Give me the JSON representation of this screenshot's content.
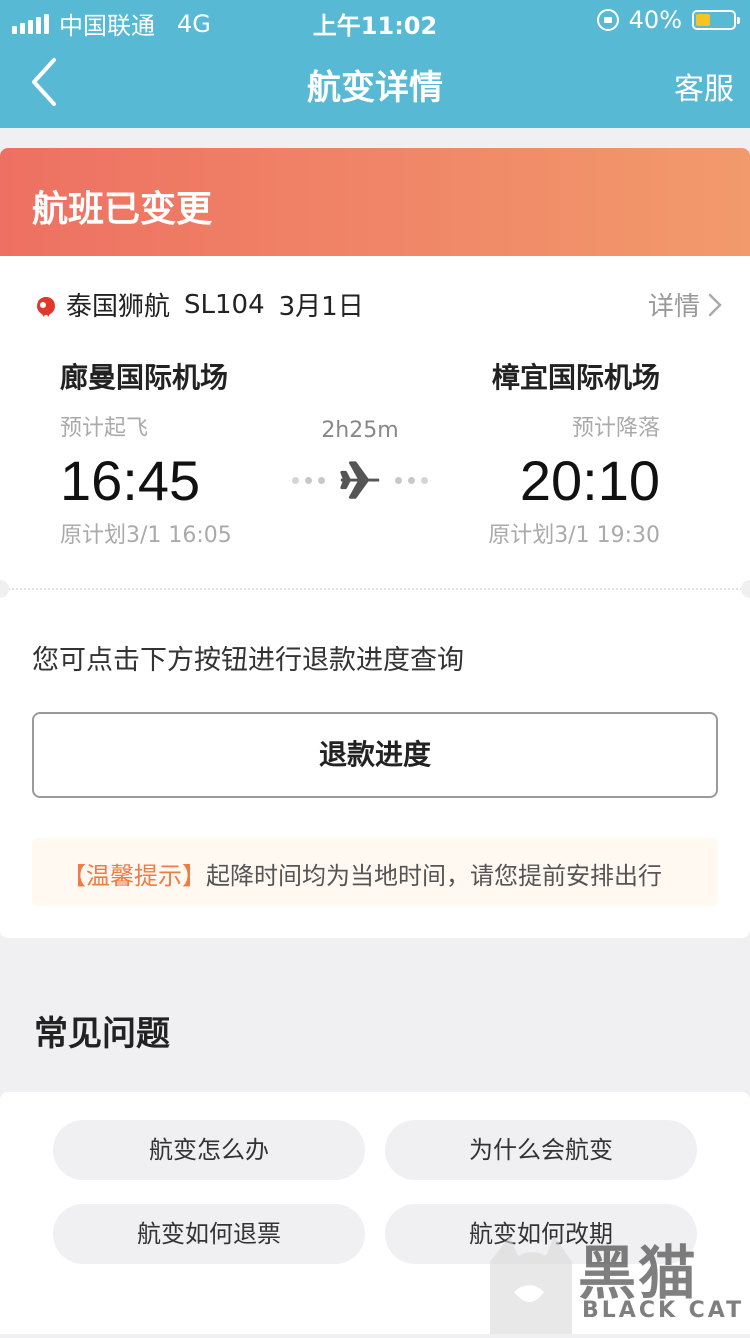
{
  "status_bar": {
    "carrier": "中国联通",
    "network": "4G",
    "time": "上午11:02",
    "battery_percent": "40%",
    "battery_level": 0.4
  },
  "nav": {
    "title": "航变详情",
    "right_label": "客服",
    "back_icon": "chevron-left-icon"
  },
  "banner": {
    "title": "航班已变更"
  },
  "flight": {
    "airline": "泰国狮航",
    "flight_no": "SL104",
    "date": "3月1日",
    "detail_label": "详情",
    "duration": "2h25m",
    "departure": {
      "airport": "廊曼国际机场",
      "label": "预计起飞",
      "time": "16:45",
      "original": "原计划3/1 16:05"
    },
    "arrival": {
      "airport": "樟宜国际机场",
      "label": "预计降落",
      "time": "20:10",
      "original": "原计划3/1 19:30"
    }
  },
  "refund": {
    "hint": "您可点击下方按钮进行退款进度查询",
    "button_label": "退款进度"
  },
  "tip": {
    "tag": "【温馨提示】",
    "text": "起降时间均为当地时间，请您提前安排出行"
  },
  "faq": {
    "title": "常见问题",
    "items": [
      "航变怎么办",
      "为什么会航变",
      "航变如何退票",
      "航变如何改期"
    ]
  },
  "watermark": {
    "cn": "黑猫",
    "en": "BLACK CAT"
  },
  "colors": {
    "header": "#58b9d4",
    "banner_start": "#ee7062",
    "banner_end": "#f29a6c",
    "tip_accent": "#f07b43"
  }
}
